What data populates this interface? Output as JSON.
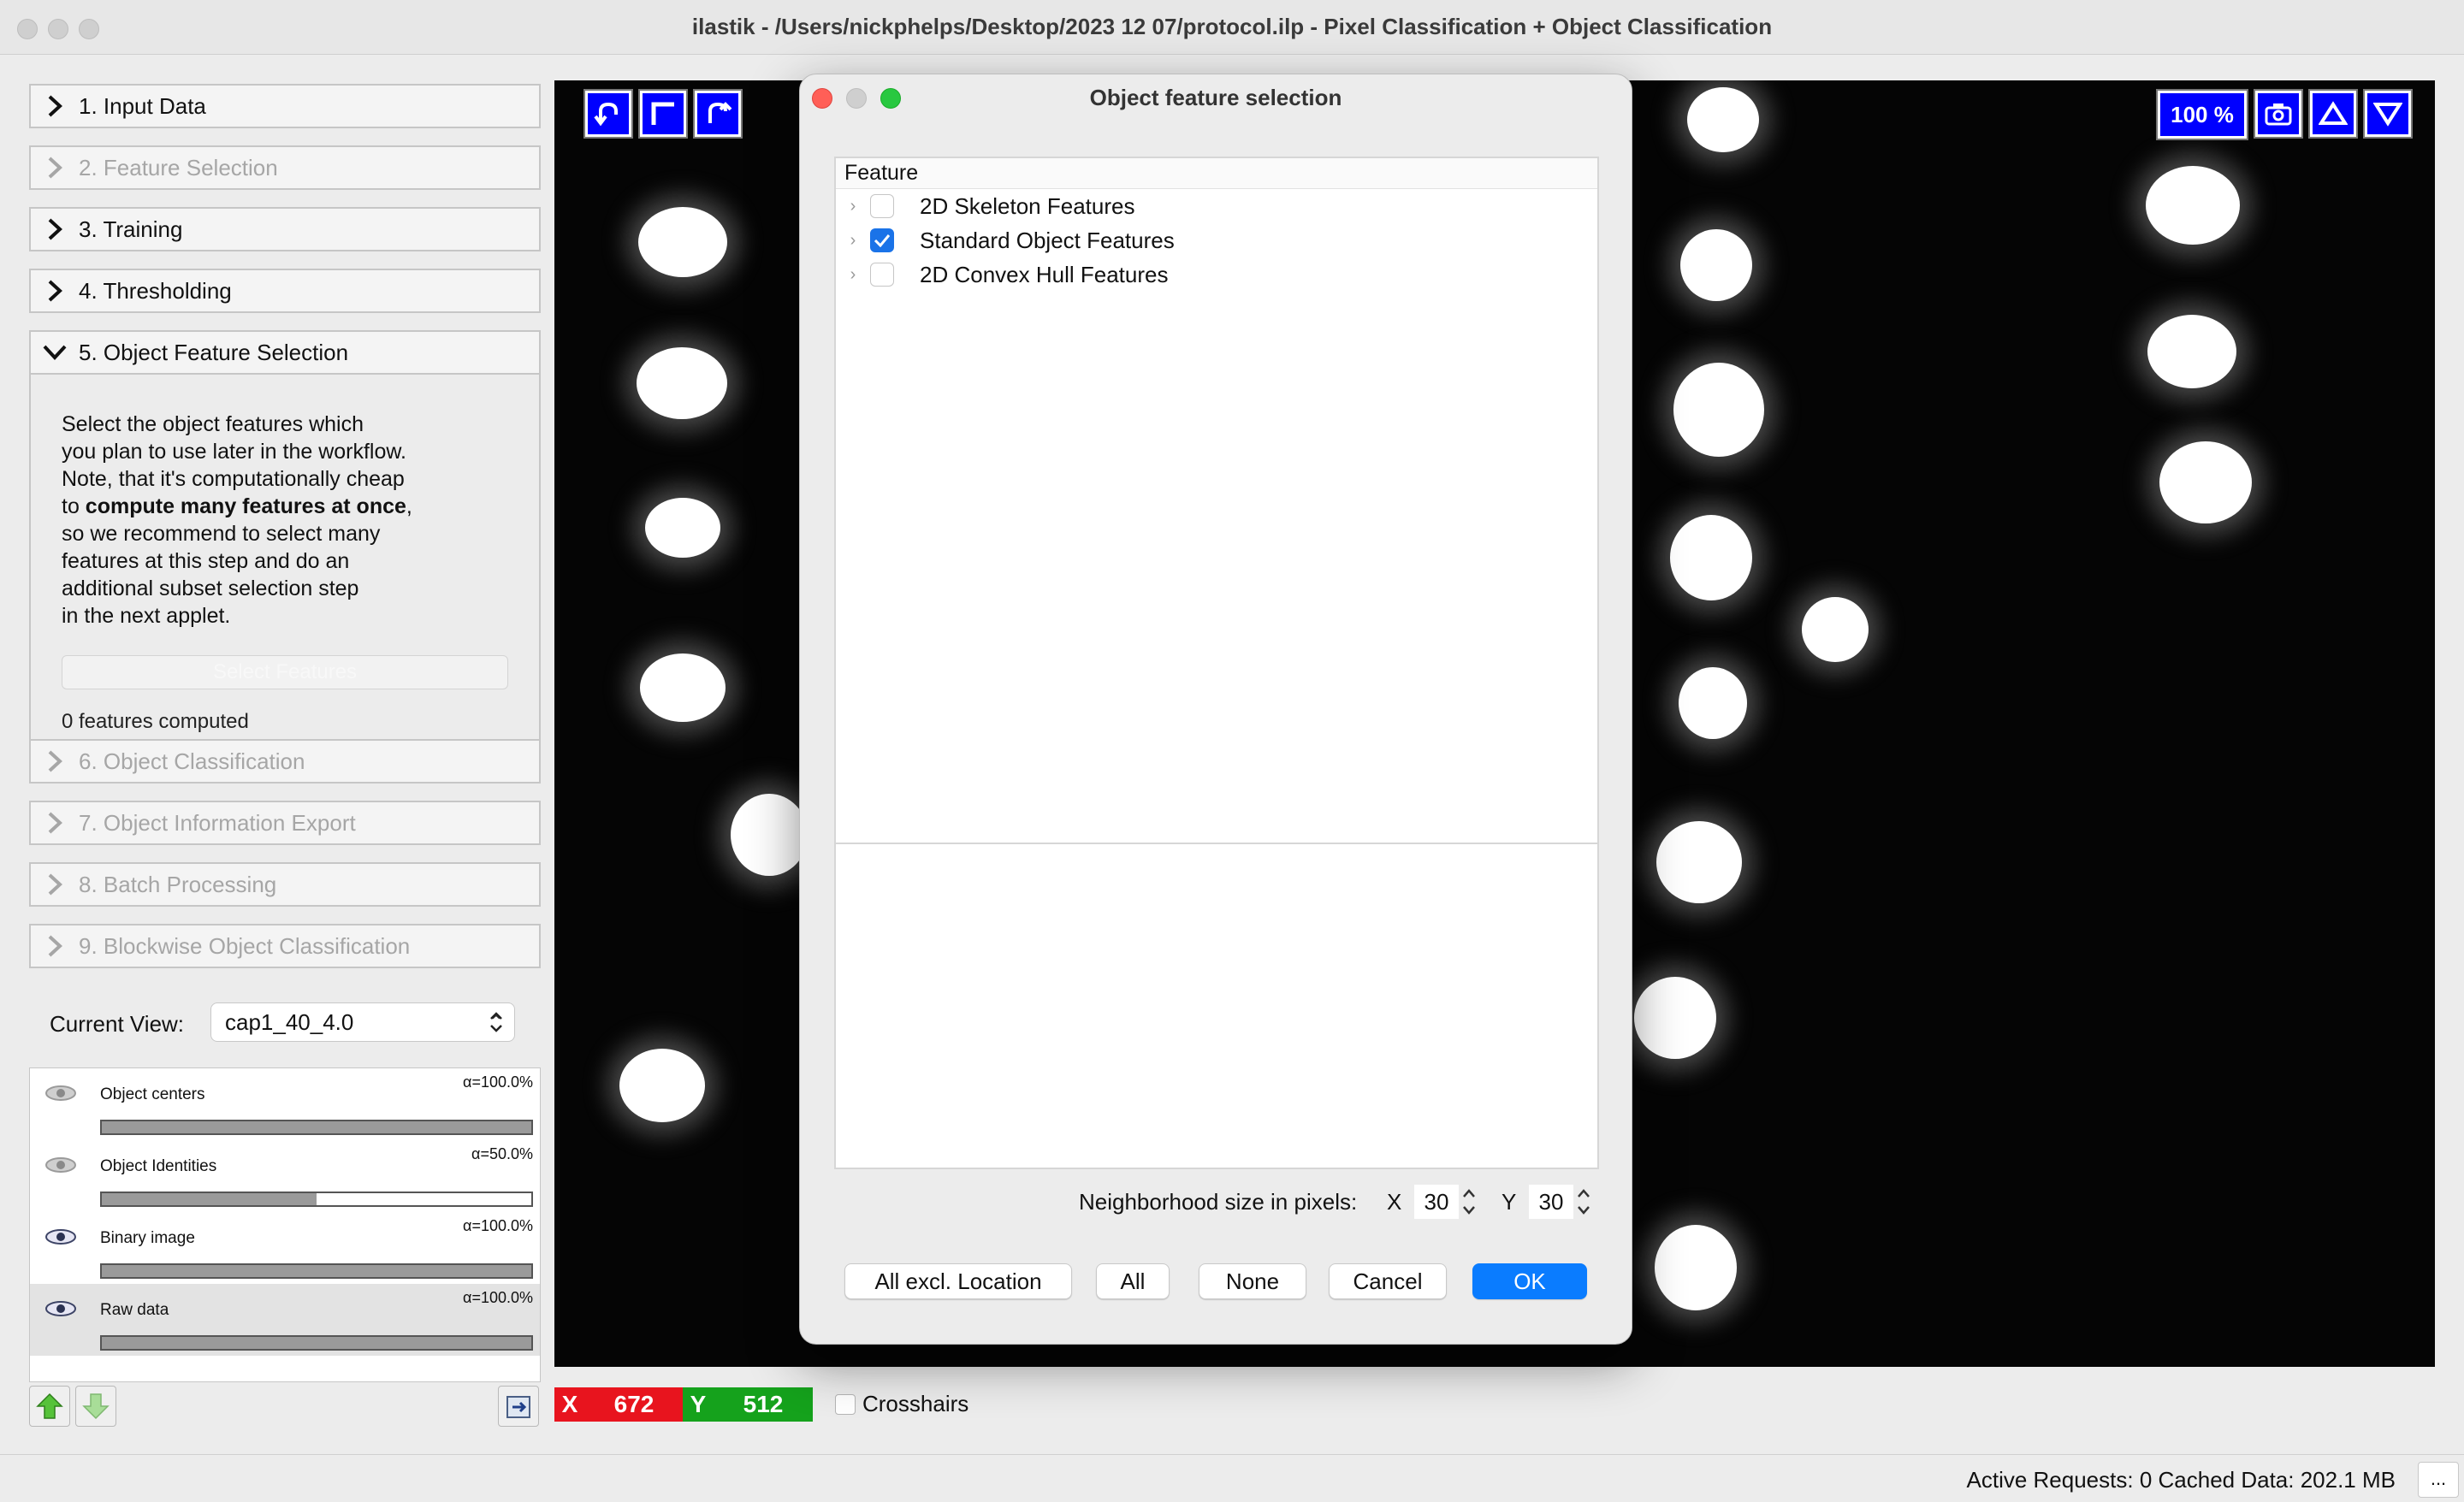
{
  "window": {
    "title": "ilastik - /Users/nickphelps/Desktop/2023 12 07/protocol.ilp - Pixel Classification + Object Classification"
  },
  "applets": [
    {
      "label": "1. Input Data",
      "enabled": true,
      "expanded": false
    },
    {
      "label": "2. Feature Selection",
      "enabled": false,
      "expanded": false
    },
    {
      "label": "3. Training",
      "enabled": true,
      "expanded": false
    },
    {
      "label": "4. Thresholding",
      "enabled": true,
      "expanded": false
    },
    {
      "label": "5. Object Feature Selection",
      "enabled": true,
      "expanded": true
    },
    {
      "label": "6. Object Classification",
      "enabled": false,
      "expanded": false
    },
    {
      "label": "7. Object Information Export",
      "enabled": false,
      "expanded": false
    },
    {
      "label": "8. Batch Processing",
      "enabled": false,
      "expanded": false
    },
    {
      "label": "9. Blockwise Object Classification",
      "enabled": false,
      "expanded": false
    }
  ],
  "object_feature_selection": {
    "desc_1": "Select the object features which",
    "desc_2": "you plan to use later in the workflow.",
    "desc_3": "Note, that it's computationally cheap",
    "desc_4a": "to ",
    "desc_4b": "compute many features at once",
    "desc_4c": ",",
    "desc_5": "so we recommend to select many",
    "desc_6": "features at this step and do an",
    "desc_7": "additional subset selection step",
    "desc_8": "in the next applet.",
    "select_button": "Select Features",
    "features_count": "0 features computed"
  },
  "current_view": {
    "label": "Current View:",
    "value": "cap1_40_4.0"
  },
  "layers": [
    {
      "name": "Object centers",
      "alpha": "α=100.0%",
      "opacity": 1.0,
      "visible": false
    },
    {
      "name": "Object Identities",
      "alpha": "α=50.0%",
      "opacity": 0.5,
      "visible": false
    },
    {
      "name": "Binary image",
      "alpha": "α=100.0%",
      "opacity": 1.0,
      "visible": true
    },
    {
      "name": "Raw data",
      "alpha": "α=100.0%",
      "opacity": 1.0,
      "visible": true
    }
  ],
  "viewer": {
    "zoom": "100 %",
    "x_label": "X",
    "x_value": "672",
    "y_label": "Y",
    "y_value": "512",
    "crosshairs_label": "Crosshairs",
    "x_color": "#e8141e",
    "y_color": "#15a21c"
  },
  "status": {
    "text": "Active Requests: 0  Cached Data: 202.1 MB",
    "button": "..."
  },
  "dialog": {
    "title": "Object feature selection",
    "column_header": "Feature",
    "features": [
      {
        "label": "2D Skeleton Features",
        "checked": false
      },
      {
        "label": "Standard Object Features",
        "checked": true
      },
      {
        "label": "2D Convex Hull Features",
        "checked": false
      }
    ],
    "neighborhood_label": "Neighborhood size in pixels:",
    "x_label": "X",
    "x_value": "30",
    "y_label": "Y",
    "y_value": "30",
    "buttons": {
      "all_excl": "All excl. Location",
      "all": "All",
      "none": "None",
      "cancel": "Cancel",
      "ok": "OK"
    },
    "accent": "#0a7cff"
  }
}
